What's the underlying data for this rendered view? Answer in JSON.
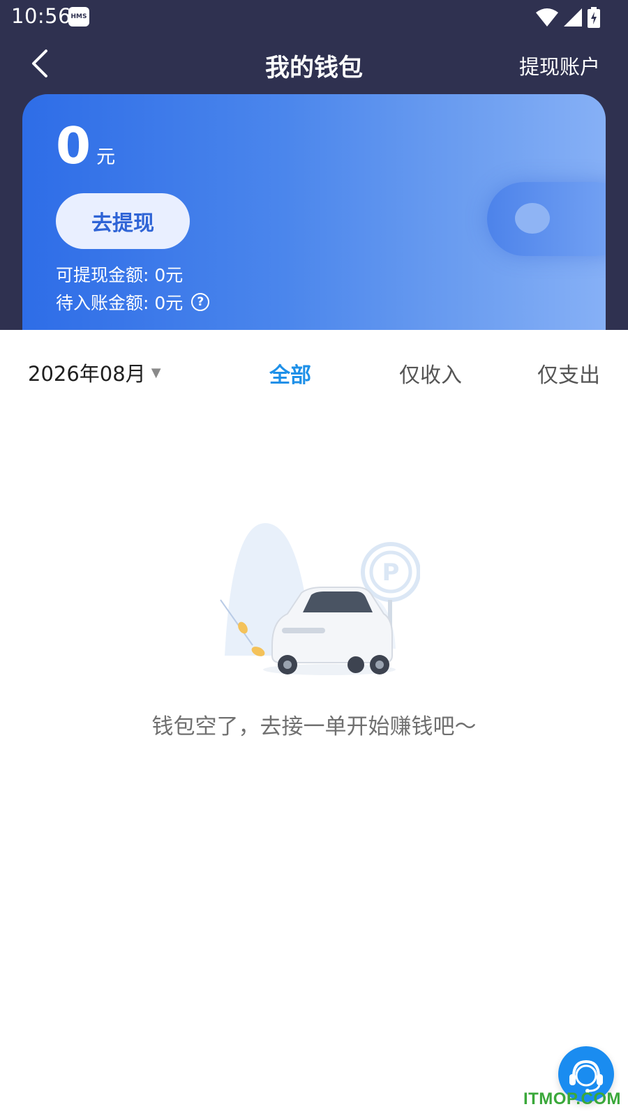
{
  "status_bar": {
    "time": "10:56",
    "badge": "HMS"
  },
  "nav": {
    "title": "我的钱包",
    "action": "提现账户"
  },
  "balance_card": {
    "amount": "0",
    "unit": "元",
    "withdraw_button": "去提现",
    "withdrawable_label": "可提现金额: 0元",
    "pending_label": "待入账金额: 0元"
  },
  "filter": {
    "month": "2026年08月",
    "tabs": [
      {
        "label": "全部",
        "active": true
      },
      {
        "label": "仅收入",
        "active": false
      },
      {
        "label": "仅支出",
        "active": false
      }
    ]
  },
  "empty_state": {
    "message": "钱包空了，去接一单开始赚钱吧～"
  },
  "watermark": "ITMOP.COM",
  "icons": [
    "back-arrow-icon",
    "wifi-icon",
    "signal-icon",
    "battery-icon",
    "help-icon",
    "dropdown-arrow-icon",
    "headset-icon",
    "parking-icon"
  ],
  "colors": {
    "header": "#2f3150",
    "accent_blue": "#1e90e8",
    "card_blue": "#2e6de7"
  }
}
